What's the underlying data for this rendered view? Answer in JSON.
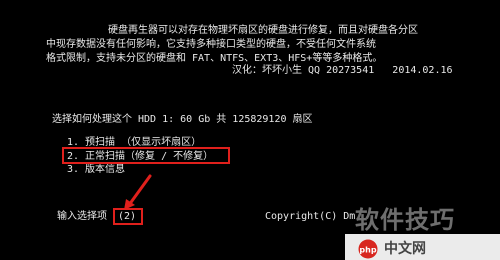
{
  "intro": {
    "line1": "硬盘再生器可以对存在物理坏扇区的硬盘进行修复，而且对硬盘各分区",
    "line2": "中现存数据没有任何影响，它支持多种接口类型的硬盘，不受任何文件系统",
    "line3": "格式限制，支持未分区的硬盘和 FAT、NTFS、EXT3、HFS+等等多种格式。",
    "credit": "汉化：坏坏小生 QQ 20273541   2014.02.16"
  },
  "prompt": "选择如何处理这个 HDD 1: 60 Gb 共 125829120 扇区",
  "options": [
    "1. 预扫描 （仅显示坏扇区）",
    "2. 正常扫描（修复 / 不修复）",
    "3. 版本信息"
  ],
  "input": {
    "label": "输入选择项",
    "value": "(2)"
  },
  "copyright": "Copyright(C) Dm",
  "watermark": {
    "text": "软件技巧",
    "badge": "中文网",
    "logo_text": "php"
  },
  "colors": {
    "highlight": "#e0201c",
    "text": "#e9e9e9",
    "background": "#000000"
  }
}
